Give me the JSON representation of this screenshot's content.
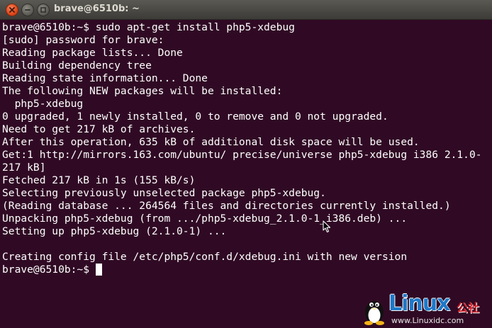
{
  "window": {
    "title": "brave@6510b: ~",
    "buttons": {
      "close_icon": "close-icon",
      "minimize_icon": "minimize-icon",
      "maximize_icon": "maximize-icon"
    }
  },
  "colors": {
    "terminal_background": "#300a24",
    "terminal_text": "#ffffff",
    "titlebar": "#3c3b37",
    "close_button": "#e0461b"
  },
  "terminal": {
    "lines": [
      "brave@6510b:~$ sudo apt-get install php5-xdebug",
      "[sudo] password for brave:",
      "Reading package lists... Done",
      "Building dependency tree",
      "Reading state information... Done",
      "The following NEW packages will be installed:",
      "  php5-xdebug",
      "0 upgraded, 1 newly installed, 0 to remove and 0 not upgraded.",
      "Need to get 217 kB of archives.",
      "After this operation, 635 kB of additional disk space will be used.",
      "Get:1 http://mirrors.163.com/ubuntu/ precise/universe php5-xdebug i386 2.1.0-",
      "217 kB]",
      "Fetched 217 kB in 1s (155 kB/s)",
      "Selecting previously unselected package php5-xdebug.",
      "(Reading database ... 264564 files and directories currently installed.)",
      "Unpacking php5-xdebug (from .../php5-xdebug_2.1.0-1_i386.deb) ...",
      "Setting up php5-xdebug (2.1.0-1) ...",
      "",
      "Creating config file /etc/php5/conf.d/xdebug.ini with new version"
    ],
    "prompt": "brave@6510b:~$ "
  },
  "watermark": {
    "logo_icon": "tux-penguin-icon",
    "brand": "Linux",
    "brand_cn": "公社",
    "url": "www.Linuxidc.com"
  }
}
